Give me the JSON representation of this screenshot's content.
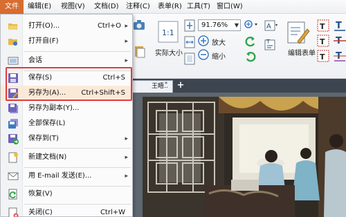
{
  "menubar": {
    "file": "文件",
    "edit": "编辑(E)",
    "view": "视图(V)",
    "document": "文档(D)",
    "comment": "注释(C)",
    "form": "表单(R)",
    "tools": "工具(T)",
    "window": "窗口(W)"
  },
  "toolbar": {
    "zoom_value": "91.76%",
    "zoom_in_label": "放大",
    "zoom_out_label": "缩小",
    "actual_size_label": "实际大小",
    "edit_form_label": "编辑表单"
  },
  "tabs": {
    "doc_tab_label": "王晤..",
    "doc_tab_modified": "*",
    "close": "×",
    "new_tab": "+"
  },
  "file_menu": {
    "items": [
      {
        "label": "打开(O)...",
        "shortcut": "Ctrl+O",
        "submenu": true
      },
      {
        "label": "打开自(F)",
        "shortcut": "",
        "submenu": true
      },
      {
        "label": "会话",
        "shortcut": "",
        "submenu": true
      },
      {
        "label": "保存(S)",
        "shortcut": "Ctrl+S",
        "submenu": false
      },
      {
        "label": "另存为(A)...",
        "shortcut": "Ctrl+Shift+S",
        "submenu": false
      },
      {
        "label": "另存为副本(Y)...",
        "shortcut": "",
        "submenu": false
      },
      {
        "label": "全部保存(L)",
        "shortcut": "",
        "submenu": false
      },
      {
        "label": "保存到(T)",
        "shortcut": "",
        "submenu": true
      },
      {
        "label": "新建文档(N)",
        "shortcut": "",
        "submenu": true
      },
      {
        "label": "用 E-mail 发送(E)...",
        "shortcut": "",
        "submenu": true
      },
      {
        "label": "恢复(V)",
        "shortcut": "",
        "submenu": false
      },
      {
        "label": "关闭(C)",
        "shortcut": "Ctrl+W",
        "submenu": false
      }
    ],
    "arrow": "▸"
  },
  "colors": {
    "file_menu_active": "#d76d31",
    "highlight_border": "#e23b3b",
    "selected_item": "#fbe9d8",
    "tabbar": "#3d4550"
  },
  "icons": {
    "open": "folder-open-icon",
    "open_from": "folder-icon",
    "session": "session-icon",
    "save": "floppy-disk-icon",
    "save_as": "floppy-disk-edit-icon",
    "save_copy": "floppy-disk-copy-icon",
    "save_all": "floppy-disk-stack-icon",
    "save_to": "floppy-disk-arrow-icon",
    "new_document": "new-document-icon",
    "email": "email-icon",
    "revert": "revert-icon",
    "close": "close-document-icon"
  }
}
